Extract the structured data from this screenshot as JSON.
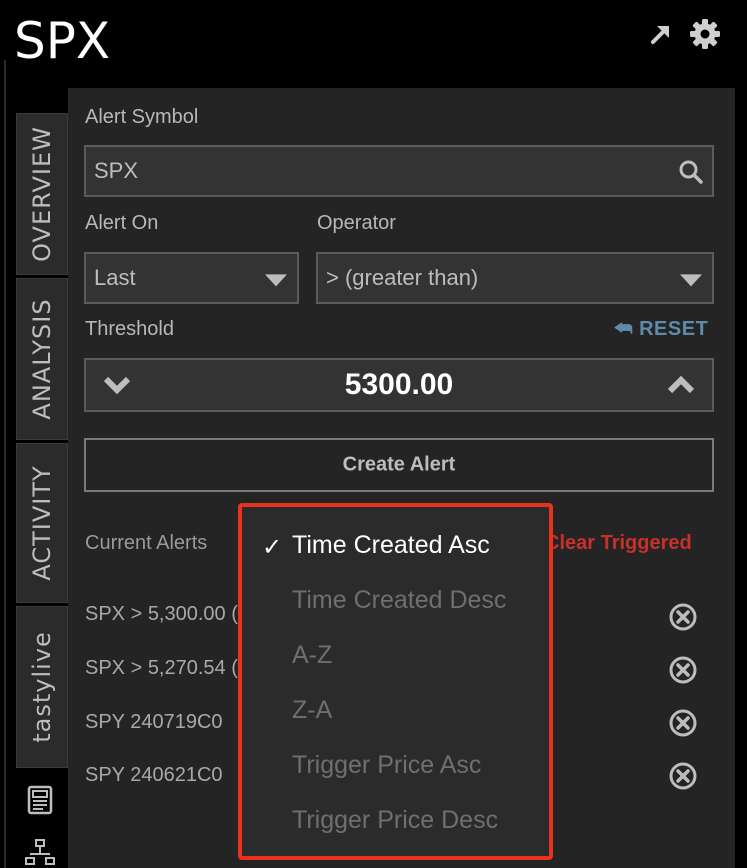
{
  "header": {
    "title": "SPX",
    "popout_icon": "popout-arrow-icon",
    "settings_icon": "gear-icon"
  },
  "side_tabs": [
    "OVERVIEW",
    "ANALYSIS",
    "ACTIVITY",
    "tastylive"
  ],
  "side_icons": [
    "document-icon",
    "hierarchy-icon"
  ],
  "form": {
    "symbol_label": "Alert Symbol",
    "symbol_value": "SPX",
    "alert_on_label": "Alert On",
    "alert_on_value": "Last",
    "operator_label": "Operator",
    "operator_value": "> (greater than)",
    "threshold_label": "Threshold",
    "reset_label": "RESET",
    "threshold_value": "5300.00",
    "create_label": "Create Alert"
  },
  "alerts": {
    "current_label": "Current Alerts",
    "clear_label": "Clear Triggered",
    "rows": [
      "SPX > 5,300.00 (",
      "SPX > 5,270.54 (",
      "SPY   240719C0",
      "SPY   240621C0"
    ]
  },
  "sort_menu": {
    "options": [
      "Time Created Asc",
      "Time Created Desc",
      "A-Z",
      "Z-A",
      "Trigger Price Asc",
      "Trigger Price Desc"
    ],
    "selected": "Time Created Asc",
    "check": "✓"
  },
  "colors": {
    "accent_link": "#5d8ba8",
    "danger": "#c8302a",
    "highlight_border": "#e8321e"
  }
}
